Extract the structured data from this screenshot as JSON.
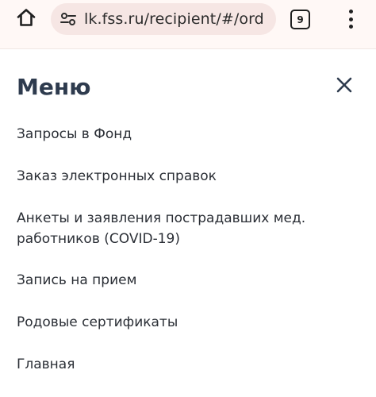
{
  "browser": {
    "url": "lk.fss.ru/recipient/#/ord",
    "tab_count": "9",
    "icons": {
      "home": "home-icon",
      "site_settings": "tune-icon",
      "tabs": "tabs-icon",
      "more": "more-vert-icon"
    }
  },
  "menu": {
    "title": "Меню",
    "close_icon": "close-icon",
    "items": [
      {
        "label": "Запросы в Фонд"
      },
      {
        "label": "Заказ электронных справок"
      },
      {
        "label": "Анкеты и заявления пострадавших мед. работников (COVID-19)"
      },
      {
        "label": "Запись на прием"
      },
      {
        "label": "Родовые сертификаты"
      },
      {
        "label": "Главная"
      }
    ]
  },
  "colors": {
    "browser_bar": "#fff8f6",
    "url_pill": "#f6e6e4",
    "title_text": "#2e3b4e",
    "item_text": "#2a2e35"
  }
}
